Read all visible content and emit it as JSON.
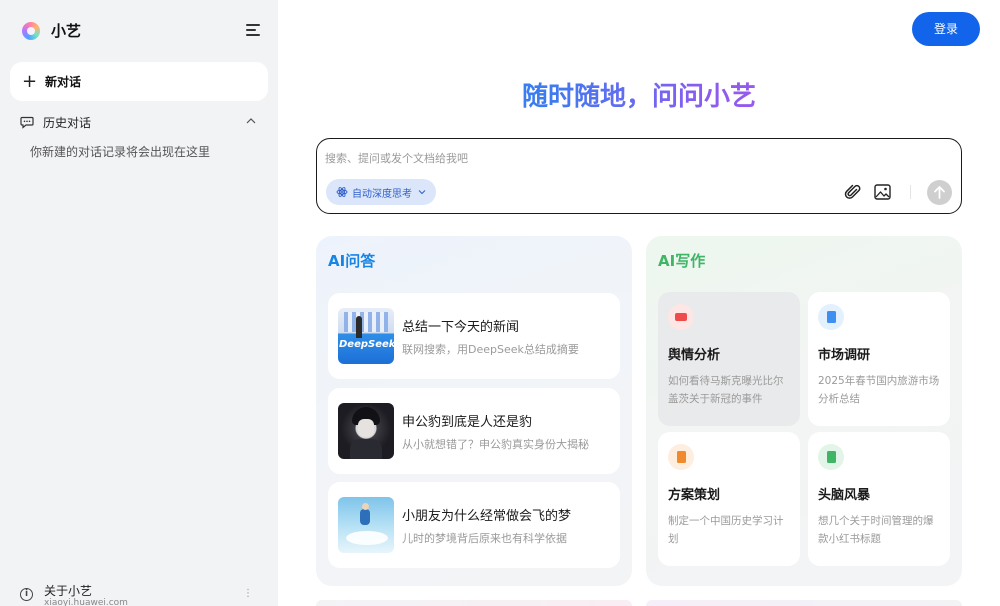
{
  "sidebar": {
    "brand_name": "小艺",
    "new_chat_label": "新对话",
    "history_label": "历史对话",
    "history_empty": "你新建的对话记录将会出现在这里",
    "about_title": "关于小艺",
    "about_url": "xiaoyi.huawei.com",
    "about_more": "⋮"
  },
  "header": {
    "login_label": "登录"
  },
  "hero": {
    "title": "随时随地，问问小艺"
  },
  "search": {
    "placeholder": "搜索、提问或发个文档给我吧",
    "deep_think_label": "自动深度思考"
  },
  "qa": {
    "title": "AI问答",
    "items": [
      {
        "title": "总结一下今天的新闻",
        "subtitle": "联网搜索，用DeepSeek总结成摘要",
        "thumb_text": "DeepSeek"
      },
      {
        "title": "申公豹到底是人还是豹",
        "subtitle": "从小就想错了？申公豹真实身份大揭秘"
      },
      {
        "title": "小朋友为什么经常做会飞的梦",
        "subtitle": "儿时的梦境背后原来也有科学依据"
      }
    ]
  },
  "write": {
    "title": "AI写作",
    "items": [
      {
        "title": "舆情分析",
        "subtitle": "如何看待马斯克曝光比尔盖茨关于新冠的事件",
        "icon_color": "#ef4b4b",
        "icon_bg": "#fde6e4"
      },
      {
        "title": "市场调研",
        "subtitle": "2025年春节国内旅游市场分析总结",
        "icon_color": "#3f8ff0",
        "icon_bg": "#e3f0fd"
      },
      {
        "title": "方案策划",
        "subtitle": "制定一个中国历史学习计划",
        "icon_color": "#f08a2c",
        "icon_bg": "#fdeee0"
      },
      {
        "title": "头脑风暴",
        "subtitle": "想几个关于时间管理的爆款小红书标题",
        "icon_color": "#3fb565",
        "icon_bg": "#e2f5e8"
      }
    ]
  }
}
